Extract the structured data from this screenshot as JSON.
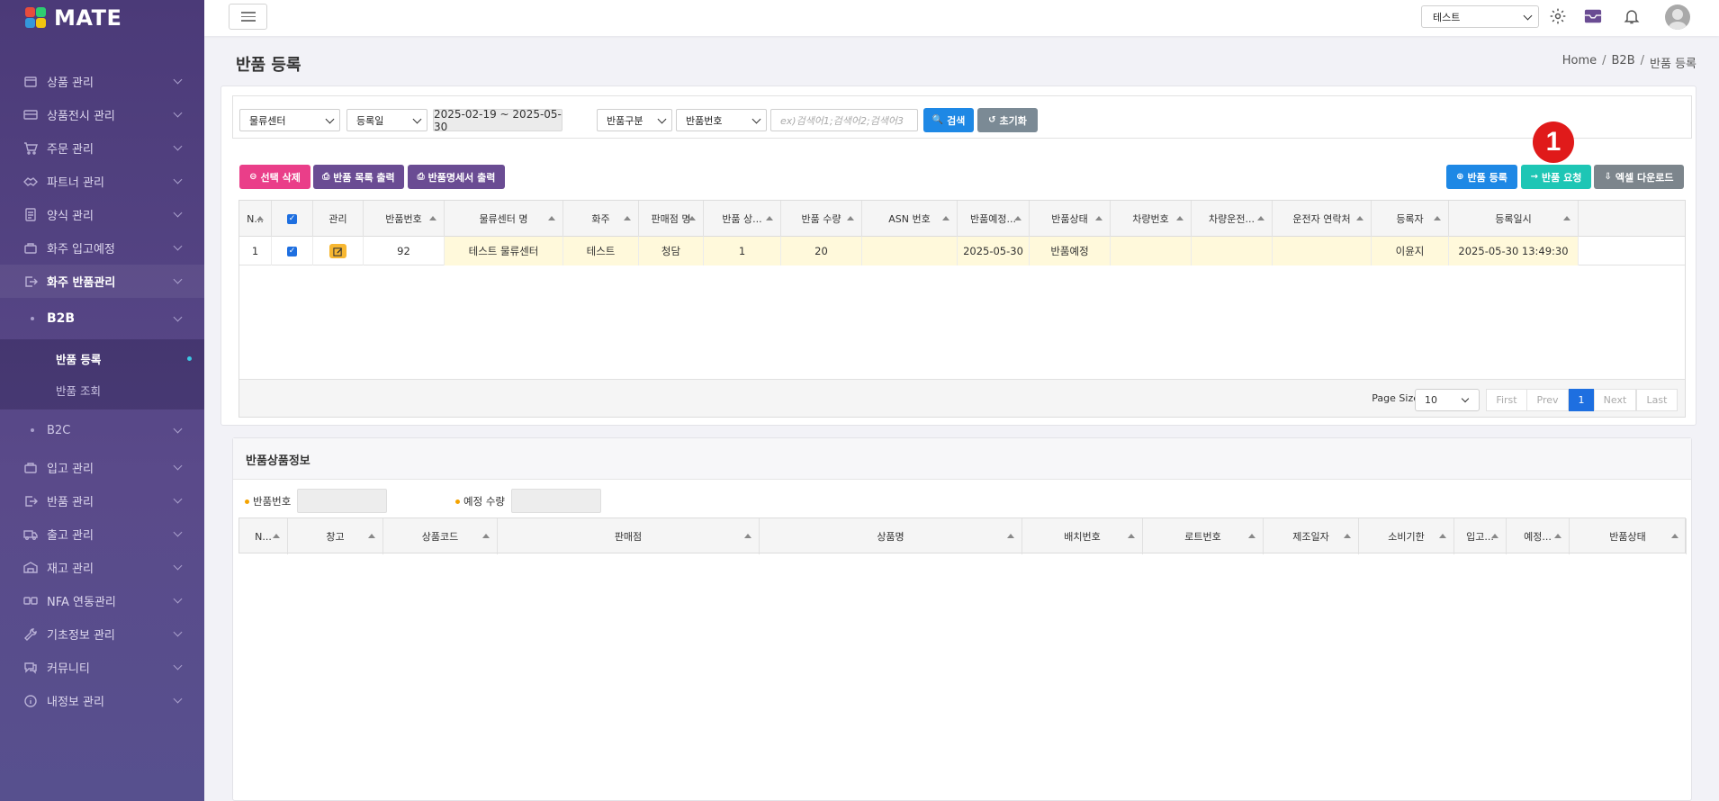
{
  "app": {
    "logo_text": "MATE"
  },
  "sidebar": {
    "items": [
      {
        "label": "상품 관리",
        "icon": "box-icon"
      },
      {
        "label": "상품전시 관리",
        "icon": "display-icon"
      },
      {
        "label": "주문 관리",
        "icon": "cart-icon"
      },
      {
        "label": "파트너 관리",
        "icon": "handshake-icon"
      },
      {
        "label": "양식 관리",
        "icon": "document-icon"
      },
      {
        "label": "화주 입고예정",
        "icon": "inbound-icon"
      },
      {
        "label": "화주 반품관리",
        "icon": "return-icon"
      }
    ],
    "sub_b2b": "B2B",
    "sub_b2b_items": [
      {
        "label": "반품 등록"
      },
      {
        "label": "반품 조회"
      }
    ],
    "sub_b2c": "B2C",
    "items_after": [
      {
        "label": "입고 관리",
        "icon": "inbound-icon"
      },
      {
        "label": "반품 관리",
        "icon": "return-icon"
      },
      {
        "label": "출고 관리",
        "icon": "truck-icon"
      },
      {
        "label": "재고 관리",
        "icon": "inventory-icon"
      },
      {
        "label": "NFA 연동관리",
        "icon": "link-icon"
      },
      {
        "label": "기초정보 관리",
        "icon": "wrench-icon"
      },
      {
        "label": "커뮤니티",
        "icon": "chat-icon"
      },
      {
        "label": "내정보 관리",
        "icon": "info-icon"
      }
    ]
  },
  "topbar": {
    "tenant_select": "테스트"
  },
  "page": {
    "title": "반품 등록",
    "breadcrumb": [
      "Home",
      "B2B",
      "반품 등록"
    ]
  },
  "filters": {
    "center_select": "물류센터",
    "date_type_select": "등록일",
    "date_range": "2025-02-19 ~ 2025-05-30",
    "return_type_select": "반품구분",
    "field_select": "반품번호",
    "search_placeholder": "ex)검색어1;검색어2;검색어3",
    "search_label": "검색",
    "reset_label": "초기화"
  },
  "actions": {
    "delete_label": "선택 삭제",
    "print_list_label": "반품 목록 출력",
    "print_statement_label": "반품명세서 출력",
    "register_label": "반품 등록",
    "request_label": "반품 요청",
    "excel_label": "엑셀 다운로드",
    "badge_number": "1"
  },
  "grid": {
    "columns": [
      "N...",
      "",
      "관리",
      "반품번호",
      "물류센터 명",
      "화주",
      "판매점 명",
      "반품 상...",
      "반품 수량",
      "ASN 번호",
      "반품예정...",
      "반품상태",
      "차량번호",
      "차량운전...",
      "운전자 연락처",
      "등록자",
      "등록일시"
    ],
    "rows": [
      {
        "no": "1",
        "return_no": "92",
        "center": "테스트 물류센터",
        "owner": "테스트",
        "store": "청담",
        "return_qty_items": "1",
        "return_qty": "20",
        "asn": "",
        "return_date": "2025-05-30",
        "status": "반품예정",
        "vehicle": "",
        "driver": "",
        "driver_phone": "",
        "registrant": "이윤지",
        "registered_at": "2025-05-30 13:49:30"
      }
    ],
    "page_size_label": "Page Size",
    "page_size": "10",
    "pager": {
      "first": "First",
      "prev": "Prev",
      "current": "1",
      "next": "Next",
      "last": "Last"
    }
  },
  "detail": {
    "title": "반품상품정보",
    "field_return_no": "반품번호",
    "field_planned_qty": "예정 수량",
    "columns": [
      "N...",
      "창고",
      "상품코드",
      "판매점",
      "상품명",
      "배치번호",
      "로트번호",
      "제조일자",
      "소비기한",
      "입고...",
      "예정...",
      "반품상태"
    ]
  }
}
